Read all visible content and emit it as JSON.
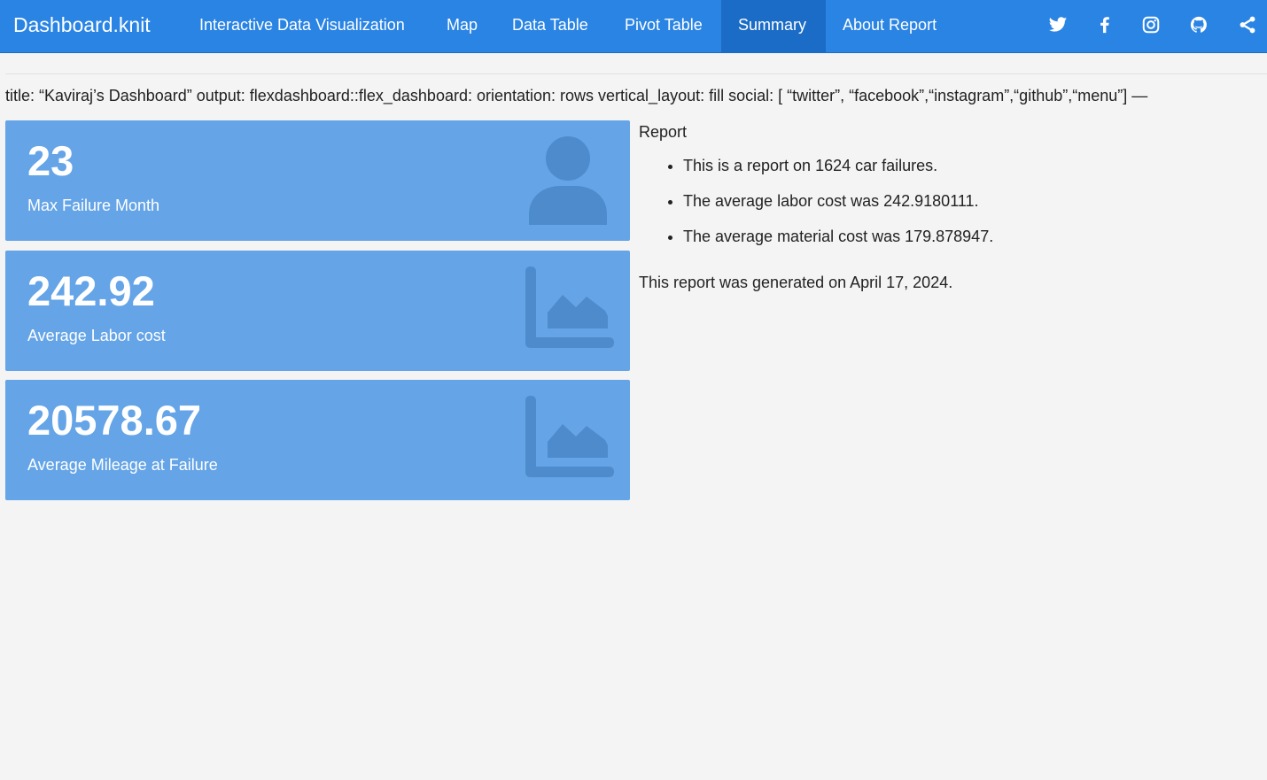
{
  "navbar": {
    "brand": "Dashboard.knit",
    "tabs": [
      {
        "label": "Interactive Data Visualization",
        "active": false
      },
      {
        "label": "Map",
        "active": false
      },
      {
        "label": "Data Table",
        "active": false
      },
      {
        "label": "Pivot Table",
        "active": false
      },
      {
        "label": "Summary",
        "active": true
      },
      {
        "label": "About Report",
        "active": false
      }
    ],
    "social_icons": [
      "twitter-icon",
      "facebook-icon",
      "instagram-icon",
      "github-icon",
      "share-icon"
    ]
  },
  "yaml_text": "title: “Kaviraj’s Dashboard” output: flexdashboard::flex_dashboard: orientation: rows vertical_layout: fill social: [ “twitter”, “facebook”,“instagram”,“github”,“menu”] —",
  "value_boxes": [
    {
      "value": "23",
      "caption": "Max Failure Month",
      "icon": "user-icon"
    },
    {
      "value": "242.92",
      "caption": "Average Labor cost",
      "icon": "area-chart-icon"
    },
    {
      "value": "20578.67",
      "caption": "Average Mileage at Failure",
      "icon": "area-chart-icon"
    }
  ],
  "report": {
    "title": "Report",
    "items": [
      "This is a report on 1624 car failures.",
      "The average labor cost was 242.9180111.",
      "The average material cost was 179.878947."
    ],
    "footer": "This report was generated on April 17, 2024."
  },
  "colors": {
    "navbar": "#2a84e4",
    "navbar_active": "#1a6cc6",
    "value_box": "#64a4e7",
    "value_box_icon": "#4e8bcc",
    "background": "#f4f4f4"
  }
}
